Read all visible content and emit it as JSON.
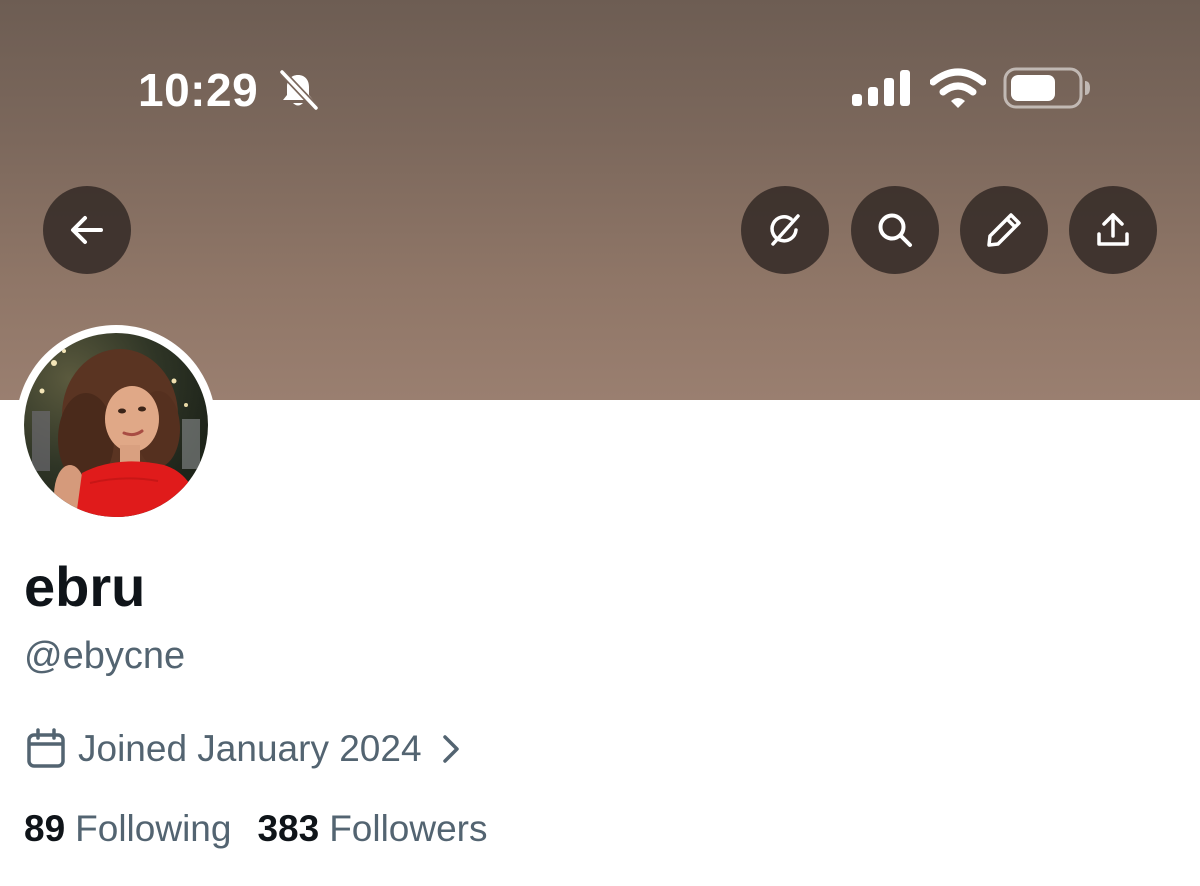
{
  "status_bar": {
    "time": "10:29",
    "icons": [
      "bell-slash-icon",
      "cellular-signal-icon",
      "wifi-icon",
      "battery-icon"
    ]
  },
  "header": {
    "buttons": [
      "back-arrow-icon",
      "grok-icon",
      "search-icon",
      "pencil-icon",
      "share-icon"
    ]
  },
  "profile": {
    "display_name": "ebru",
    "handle": "@ebycne",
    "joined": "Joined January 2024",
    "following": {
      "count": "89",
      "label": "Following"
    },
    "followers": {
      "count": "383",
      "label": "Followers"
    }
  },
  "colors": {
    "banner_top": "#6d5d53",
    "banner_bottom": "#9a7f70",
    "button_bg": "#3a2f2a",
    "text_primary": "#0f1419",
    "text_secondary": "#536471"
  }
}
